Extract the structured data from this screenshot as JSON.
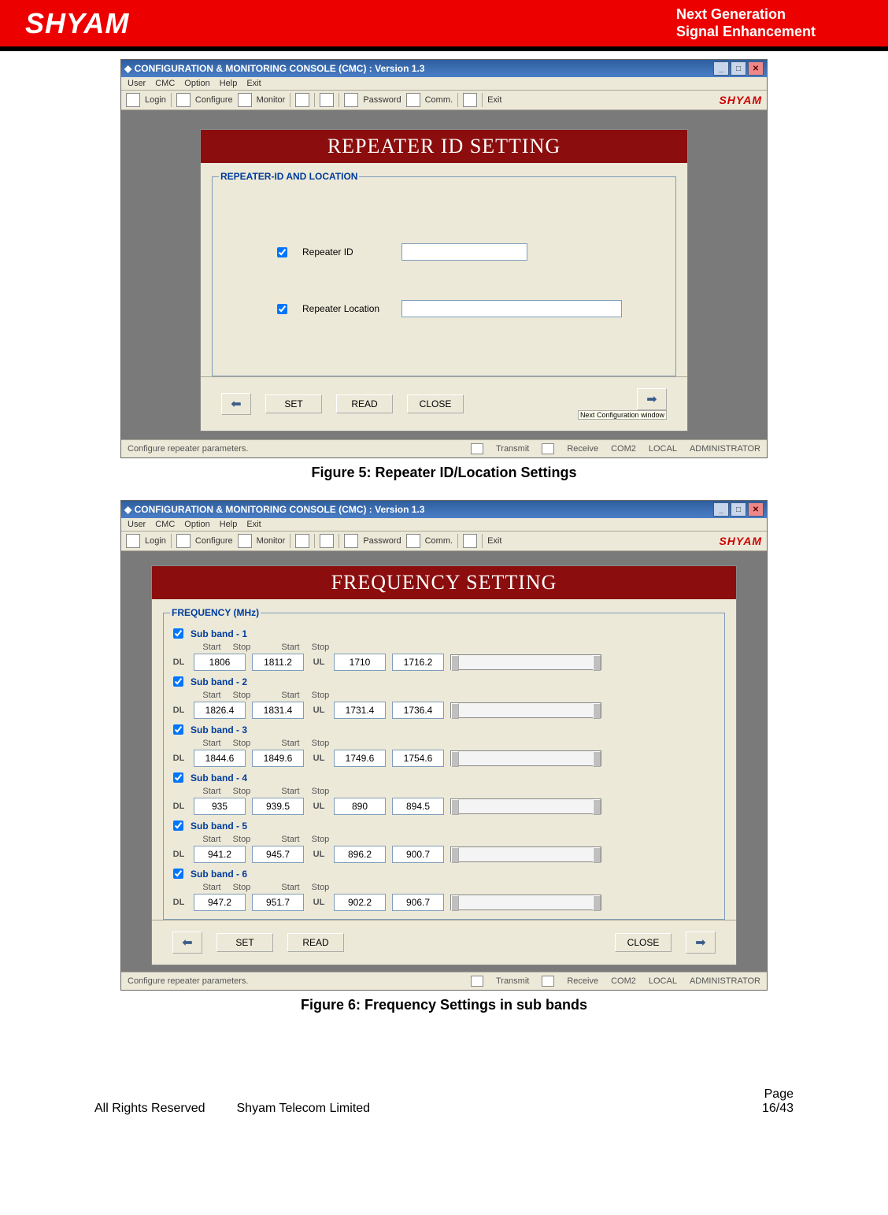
{
  "header": {
    "logo": "SHYAM",
    "tag1": "Next Generation",
    "tag2": "Signal Enhancement"
  },
  "app": {
    "title": "CONFIGURATION & MONITORING CONSOLE (CMC)  :  Version 1.3",
    "menu": [
      "User",
      "CMC",
      "Option",
      "Help",
      "Exit"
    ],
    "toolbar": {
      "login": "Login",
      "configure": "Configure",
      "monitor": "Monitor",
      "password": "Password",
      "comm": "Comm.",
      "exit": "Exit"
    },
    "brand": "SHYAM",
    "status": {
      "note": "Configure repeater parameters.",
      "transmit": "Transmit",
      "receive": "Receive",
      "port": "COM2",
      "mode": "LOCAL",
      "role": "ADMINISTRATOR"
    }
  },
  "fig5": {
    "panel_title": "REPEATER ID SETTING",
    "legend": "REPEATER-ID AND LOCATION",
    "repeater_id_label": "Repeater ID",
    "repeater_loc_label": "Repeater Location",
    "btn_set": "SET",
    "btn_read": "READ",
    "btn_close": "CLOSE",
    "tooltip": "Next Configuration window",
    "caption": "Figure 5: Repeater ID/Location Settings"
  },
  "fig6": {
    "panel_title": "FREQUENCY SETTING",
    "legend": "FREQUENCY (MHz)",
    "col": {
      "start": "Start",
      "stop": "Stop",
      "dl": "DL",
      "ul": "UL"
    },
    "subbands": [
      {
        "name": "Sub band - 1",
        "dlStart": "1806",
        "dlStop": "1811.2",
        "ulStart": "1710",
        "ulStop": "1716.2"
      },
      {
        "name": "Sub band - 2",
        "dlStart": "1826.4",
        "dlStop": "1831.4",
        "ulStart": "1731.4",
        "ulStop": "1736.4"
      },
      {
        "name": "Sub band - 3",
        "dlStart": "1844.6",
        "dlStop": "1849.6",
        "ulStart": "1749.6",
        "ulStop": "1754.6"
      },
      {
        "name": "Sub band - 4",
        "dlStart": "935",
        "dlStop": "939.5",
        "ulStart": "890",
        "ulStop": "894.5"
      },
      {
        "name": "Sub band - 5",
        "dlStart": "941.2",
        "dlStop": "945.7",
        "ulStart": "896.2",
        "ulStop": "900.7"
      },
      {
        "name": "Sub band - 6",
        "dlStart": "947.2",
        "dlStop": "951.7",
        "ulStart": "902.2",
        "ulStop": "906.7"
      }
    ],
    "btn_set": "SET",
    "btn_read": "READ",
    "btn_close": "CLOSE",
    "caption": "Figure 6: Frequency Settings in sub bands"
  },
  "footer": {
    "rights": "All Rights Reserved",
    "company": "Shyam Telecom Limited",
    "page_label": "Page",
    "page_num": "16/43"
  }
}
